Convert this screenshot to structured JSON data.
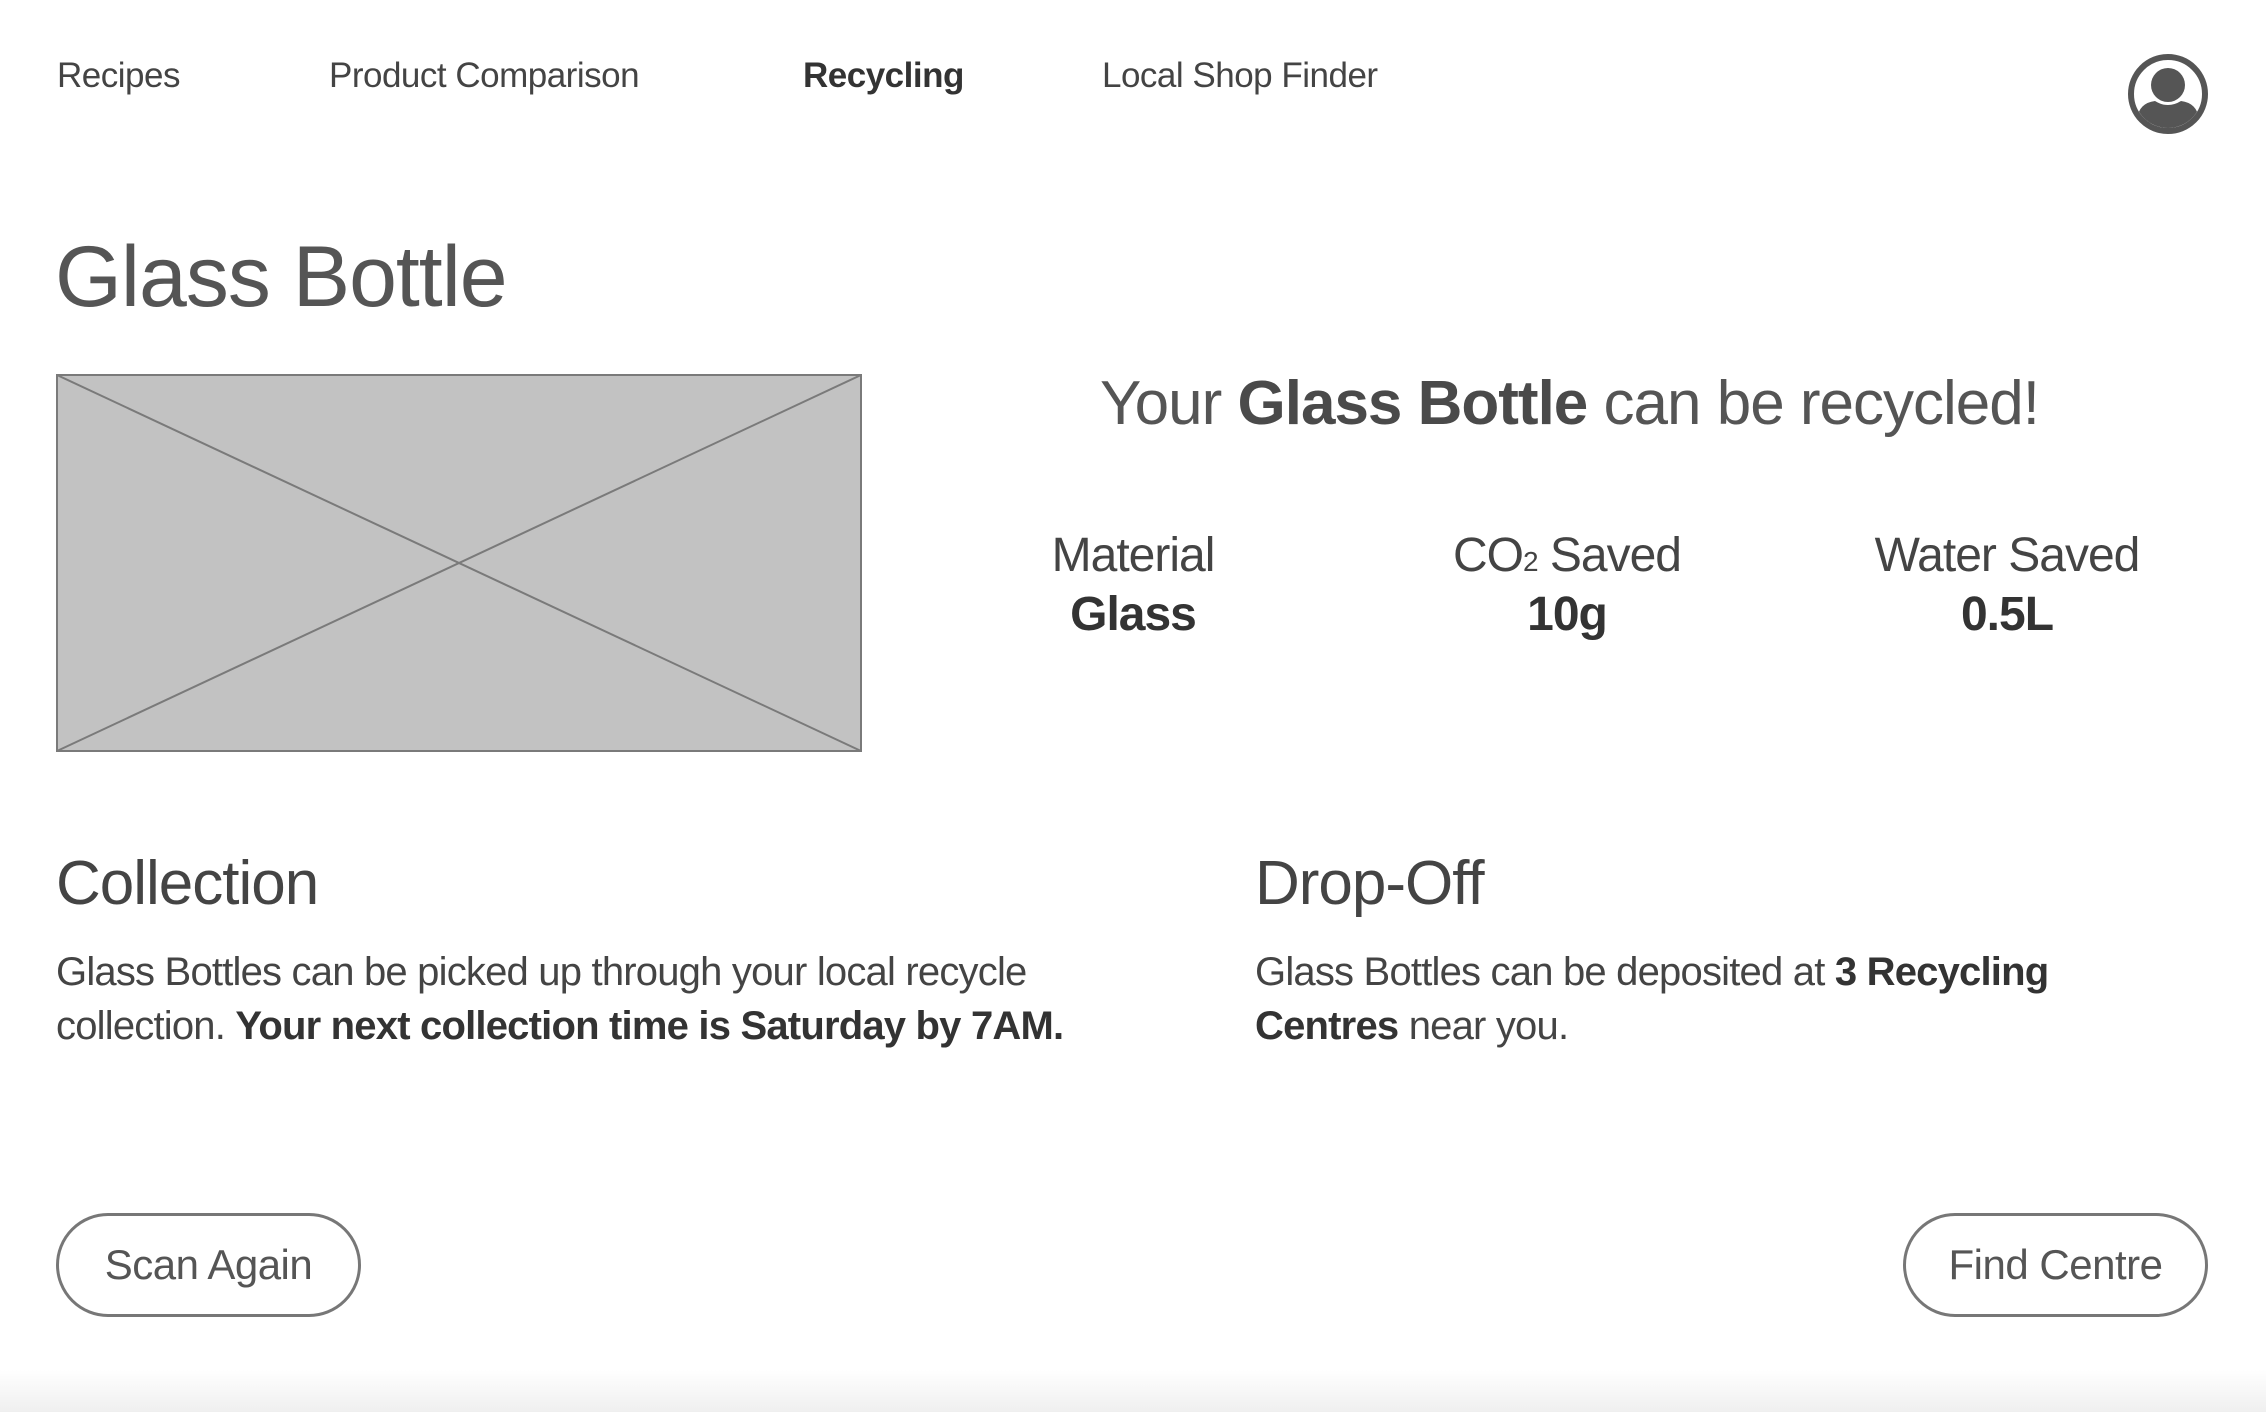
{
  "nav": {
    "items": [
      {
        "label": "Recipes",
        "active": false
      },
      {
        "label": "Product Comparison",
        "active": false
      },
      {
        "label": "Recycling",
        "active": true
      },
      {
        "label": "Local Shop Finder",
        "active": false
      }
    ],
    "avatar_icon": "user-circle-icon"
  },
  "product": {
    "title": "Glass Bottle",
    "image_icon": "image-placeholder-icon"
  },
  "headline": {
    "prefix": "Your",
    "product": "Glass Bottle",
    "suffix": "can be recycled!"
  },
  "stats": [
    {
      "label": "Material",
      "value": "Glass"
    },
    {
      "label_main": "CO",
      "label_sub": "2",
      "label_rest": " Saved",
      "value": "10g"
    },
    {
      "label": "Water Saved",
      "value": "0.5L"
    }
  ],
  "collection": {
    "title": "Collection",
    "text": "Glass Bottles can be picked up through your local recycle collection.",
    "bold_text": "Your next collection time is Saturday by 7AM."
  },
  "dropoff": {
    "title": "Drop-Off",
    "text_before": "Glass Bottles can be deposited at",
    "bold_text": "3 Recycling Centres",
    "text_after": "near you."
  },
  "buttons": {
    "scan_again": "Scan Again",
    "find_centre": "Find Centre"
  },
  "colors": {
    "text": "#555555",
    "text_dark": "#333333",
    "placeholder_fill": "#c2c2c2",
    "placeholder_stroke": "#7a7a7a",
    "button_border": "#777777"
  }
}
